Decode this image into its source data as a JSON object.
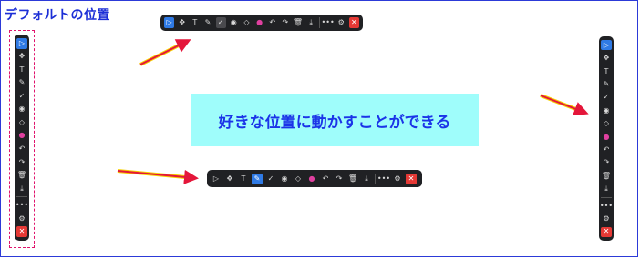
{
  "heading": "デフォルトの位置",
  "caption": "好きな位置に動かすことができる",
  "colors": {
    "accent": "#2f7ae5",
    "close": "#e53935",
    "pen": "#e040a0",
    "arrow": "#e4163a",
    "caption_bg": "#9ffdfb"
  },
  "toolbar_icons": {
    "select": "▷",
    "move": "✥",
    "text": "T",
    "pen": "✎",
    "check": "✓",
    "circle": "◉",
    "eraser": "◇",
    "color": "●",
    "undo": "↶",
    "redo": "↷",
    "trash": "🗑",
    "download": "⤓",
    "more": "•••",
    "settings": "⚙",
    "close": "✕"
  }
}
